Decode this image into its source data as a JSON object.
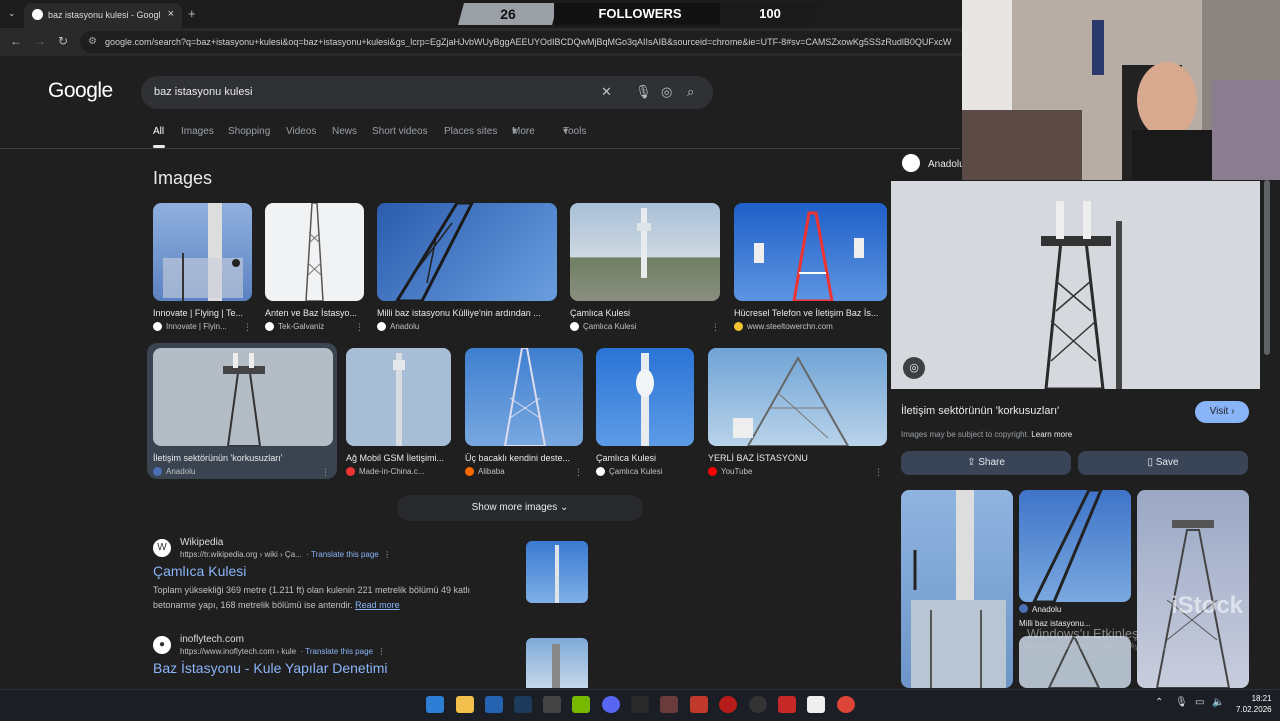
{
  "browser": {
    "tab_title": "baz istasyonu kulesi - Google Sea",
    "url": "google.com/search?q=baz+istasyonu+kulesi&oq=baz+istasyonu+kulesi&gs_lcrp=EgZjaHJvbWUyBggAEEUYOdIBCDQwMjBqMGo3qAIIsAIB&sourceid=chrome&ie=UTF-8#sv=CAMSZxowKg5SSzRudlB0QUFxcW"
  },
  "overlay": {
    "left_count": "26",
    "label": "FOLLOWERS",
    "right_count": "100"
  },
  "google": {
    "logo": "Google",
    "query": "baz istasyonu kulesi",
    "tabs": [
      "All",
      "Images",
      "Shopping",
      "Videos",
      "News",
      "Short videos",
      "Places sites",
      "More",
      "Tools"
    ],
    "images_heading": "Images",
    "show_more": "Show more images"
  },
  "images_row1": [
    {
      "caption": "Innovate | Flying | Te...",
      "source": "Innovate | Flyin...",
      "color": "#6d8fc6"
    },
    {
      "caption": "Anten ve Baz İstasyo...",
      "source": "Tek-Galvaniz",
      "color": "#e9ecef"
    },
    {
      "caption": "Milli baz istasyonu Külliye'nin ardından ...",
      "source": "Anadolu",
      "color": "#3f6fc0"
    },
    {
      "caption": "Çamlıca Kulesi",
      "source": "Çamlıca Kulesi",
      "color": "#8fa9c9"
    },
    {
      "caption": "Hücresel Telefon ve İletişim Baz İs...",
      "source": "www.steeltowerchn.com",
      "color": "#2f6fd0"
    }
  ],
  "images_row2": [
    {
      "caption": "İletişim sektörünün 'korkusuzları'",
      "source": "Anadolu",
      "color": "#aab3c0"
    },
    {
      "caption": "Ağ Mobil GSM İletişimi...",
      "source": "Made-in-China.c...",
      "color": "#9fb4cf"
    },
    {
      "caption": "Üç bacaklı kendini deste...",
      "source": "Alibaba",
      "color": "#5f8fd0"
    },
    {
      "caption": "Çamlıca Kulesi",
      "source": "Çamlıca Kulesi",
      "color": "#4d89d8"
    },
    {
      "caption": "YERLİ BAZ İSTASYONU",
      "source": "YouTube",
      "color": "#8fb6dc"
    }
  ],
  "results": [
    {
      "site": "Wikipedia",
      "url": "https://tr.wikipedia.org › wiki › Ça...",
      "translate": "Translate this page",
      "title": "Çamlıca Kulesi",
      "snippet": "Toplam yüksekliği 369 metre (1.211 ft) olan kulenin 221 metrelik bölümü 49 katlı betonarme yapı, 168 metrelik bölümü ise antendir.",
      "read_more": "Read more",
      "logo": "W"
    },
    {
      "site": "inoflytech.com",
      "url": "https://www.inoflytech.com › kule",
      "translate": "Translate this page",
      "title": "Baz İstasyonu - Kule Yapılar Denetimi",
      "snippet": "",
      "read_more": "",
      "logo": "●"
    }
  ],
  "panel": {
    "source": "Anadolu",
    "title": "İletişim sektörünün 'korkusuzları'",
    "visit": "Visit",
    "copyright": "Images may be subject to copyright.",
    "learn_more": "Learn more",
    "share": "Share",
    "save": "Save",
    "related_source": "Anadolu",
    "related_caption": "Milli baz istasyonu...",
    "watermark": "Windows'u Etkinleş",
    "watermark_sub": "Windows'u etkinleştirmek için Ayarlar'a gidin",
    "istock": "iStock"
  },
  "taskbar": {
    "time": "18:21",
    "date": "7.02.2026"
  }
}
